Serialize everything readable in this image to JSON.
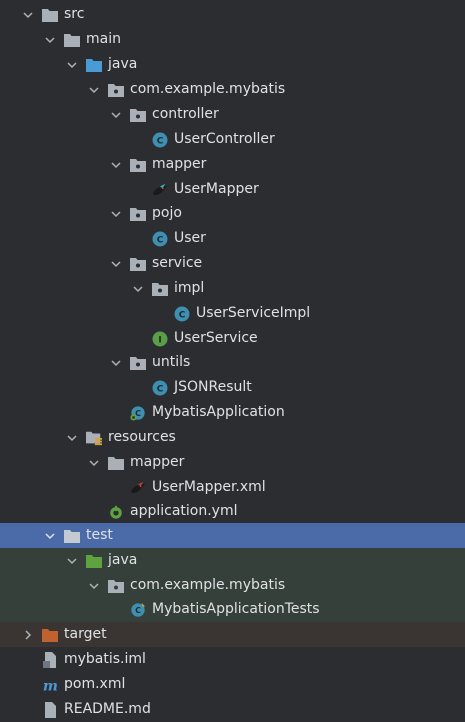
{
  "project_tree": {
    "src": "src",
    "main": "main",
    "java": "java",
    "pkg_main": "com.example.mybatis",
    "controller": "controller",
    "user_controller": "UserController",
    "mapper": "mapper",
    "user_mapper": "UserMapper",
    "pojo": "pojo",
    "user": "User",
    "service": "service",
    "impl": "impl",
    "user_service_impl": "UserServiceImpl",
    "user_service": "UserService",
    "untils": "untils",
    "json_result": "JSONResult",
    "mybatis_application": "MybatisApplication",
    "resources": "resources",
    "res_mapper": "mapper",
    "user_mapper_xml": "UserMapper.xml",
    "application_yml": "application.yml",
    "test": "test",
    "test_java": "java",
    "pkg_test": "com.example.mybatis",
    "mybatis_application_tests": "MybatisApplicationTests",
    "target": "target",
    "mybatis_iml": "mybatis.iml",
    "pom_xml": "pom.xml",
    "readme": "README.md"
  },
  "colors": {
    "background": "#2b2d30",
    "selection": "#4a6aa8",
    "folder": "#a9b0b8",
    "source_folder": "#4a9ad6",
    "test_folder": "#5fa340",
    "excluded_folder": "#c0622f",
    "class_icon": "#3e8fb0",
    "interface_icon": "#5a9e4a"
  }
}
